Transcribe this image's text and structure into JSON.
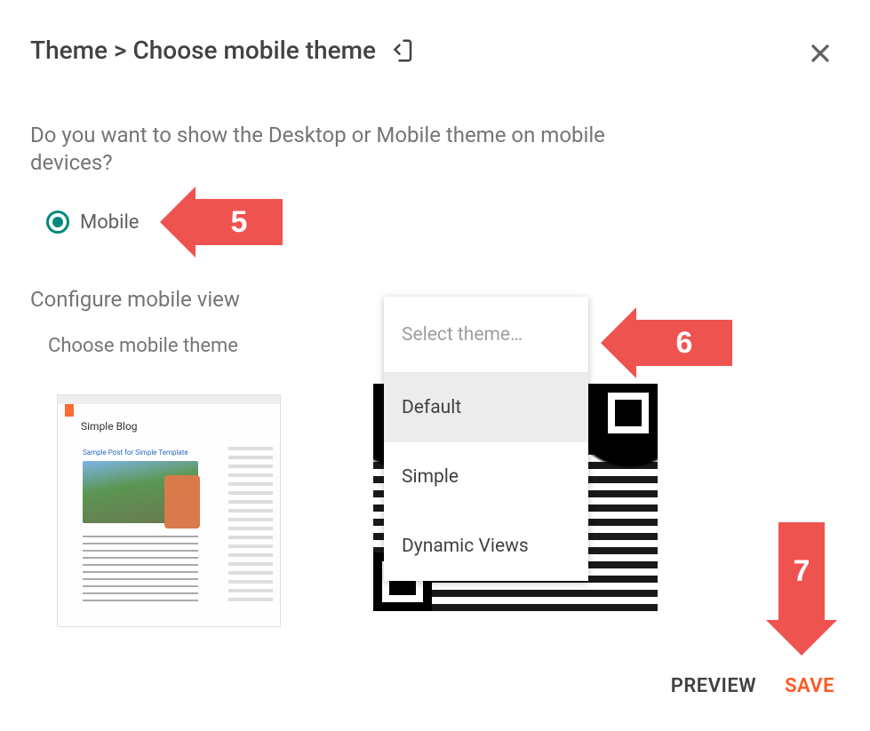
{
  "breadcrumb": "Theme > Choose mobile theme",
  "question": "Do you want to show the Desktop or Mobile theme on mobile devices?",
  "radio": {
    "label": "Mobile"
  },
  "section_title": "Configure mobile view",
  "field_label": "Choose mobile theme",
  "thumb_title": "Simple Blog",
  "thumb_subtitle": "Sample Post for Simple Template",
  "dropdown": {
    "placeholder": "Select theme…",
    "items": [
      "Default",
      "Simple",
      "Dynamic Views"
    ]
  },
  "footer": {
    "preview": "PREVIEW",
    "save": "SAVE"
  },
  "annotations": {
    "a5": "5",
    "a6": "6",
    "a7": "7"
  }
}
